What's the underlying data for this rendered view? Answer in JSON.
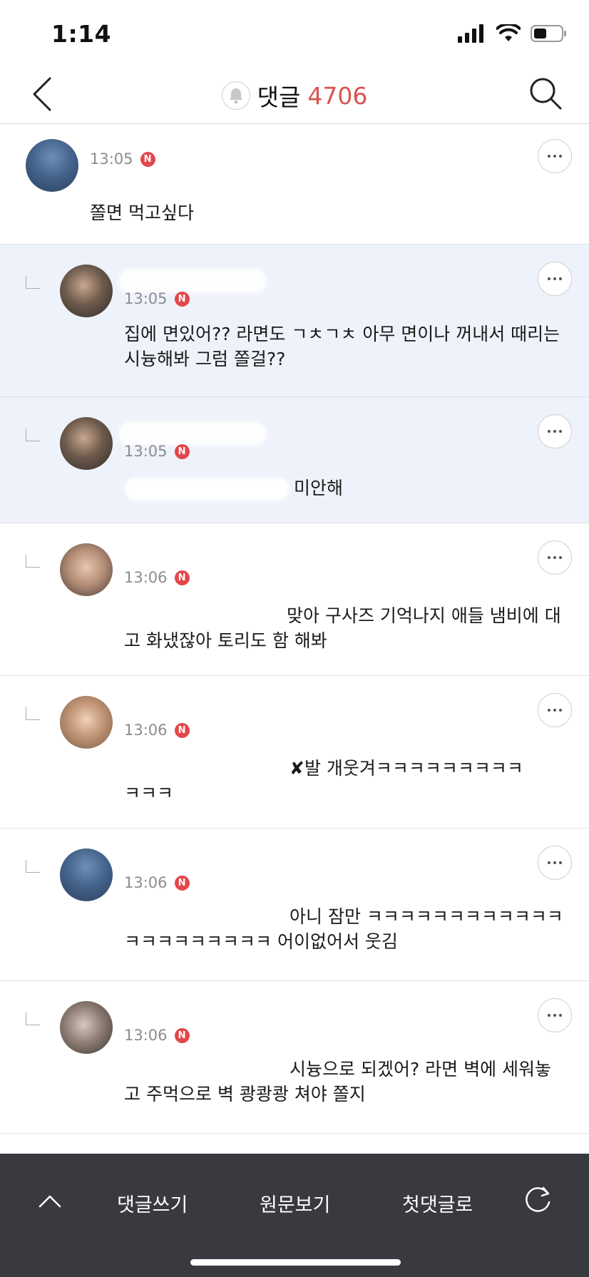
{
  "status": {
    "time": "1:14"
  },
  "header": {
    "title": "댓글",
    "count": "4706"
  },
  "comments": [
    {
      "time": "13:05",
      "badge": "N",
      "text": "쫄면 먹고싶다"
    },
    {
      "time": "13:05",
      "badge": "N",
      "text": "집에 면있어?? 라면도 ㄱㅊㄱㅊ 아무 면이나 꺼내서 때리는 시늉해봐 그럼 쫄걸??"
    },
    {
      "time": "13:05",
      "badge": "N",
      "text": "미안해"
    },
    {
      "time": "13:06",
      "badge": "N",
      "text": "맞아 구사즈 기억나지 애들 냄비에 대고 화냈잖아 토리도 함 해봐"
    },
    {
      "time": "13:06",
      "badge": "N",
      "text": "✘발 개웃겨ㅋㅋㅋㅋㅋㅋㅋㅋㅋㅋㅋㅋ"
    },
    {
      "time": "13:06",
      "badge": "N",
      "text": "아니 잠만 ㅋㅋㅋㅋㅋㅋㅋㅋㅋㅋㅋㅋㅋㅋㅋㅋㅋㅋㅋㅋㅋ 어이없어서 웃김"
    },
    {
      "time": "13:06",
      "badge": "N",
      "text": "시늉으로 되겠어? 라면 벽에 세워놓고 주먹으로 벽 쾅쾅쾅 쳐야 쫄지"
    }
  ],
  "bottom_bar": {
    "write": "댓글쓰기",
    "original": "원문보기",
    "first": "첫댓글로"
  },
  "icons": {
    "back": "chevron-left-icon",
    "bell": "bell-icon",
    "search": "search-icon",
    "more": "more-icon",
    "up": "chevron-up-icon",
    "refresh": "refresh-icon"
  },
  "colors": {
    "accent": "#d9534f",
    "badge": "#e2474b",
    "highlight": "#eef2fa",
    "bottom_bar": "#383a40"
  }
}
